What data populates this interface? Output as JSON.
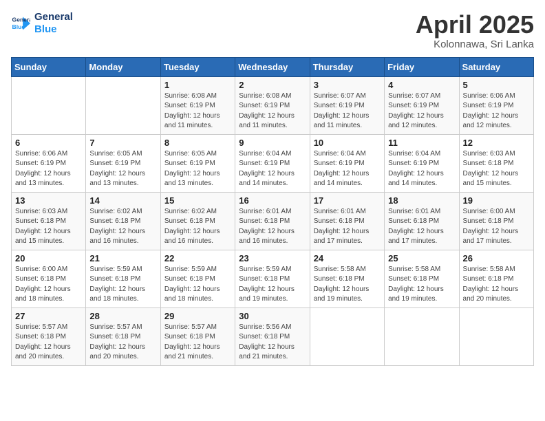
{
  "header": {
    "logo_line1": "General",
    "logo_line2": "Blue",
    "title": "April 2025",
    "subtitle": "Kolonnawa, Sri Lanka"
  },
  "days_of_week": [
    "Sunday",
    "Monday",
    "Tuesday",
    "Wednesday",
    "Thursday",
    "Friday",
    "Saturday"
  ],
  "weeks": [
    [
      {
        "day": "",
        "info": ""
      },
      {
        "day": "",
        "info": ""
      },
      {
        "day": "1",
        "info": "Sunrise: 6:08 AM\nSunset: 6:19 PM\nDaylight: 12 hours\nand 11 minutes."
      },
      {
        "day": "2",
        "info": "Sunrise: 6:08 AM\nSunset: 6:19 PM\nDaylight: 12 hours\nand 11 minutes."
      },
      {
        "day": "3",
        "info": "Sunrise: 6:07 AM\nSunset: 6:19 PM\nDaylight: 12 hours\nand 11 minutes."
      },
      {
        "day": "4",
        "info": "Sunrise: 6:07 AM\nSunset: 6:19 PM\nDaylight: 12 hours\nand 12 minutes."
      },
      {
        "day": "5",
        "info": "Sunrise: 6:06 AM\nSunset: 6:19 PM\nDaylight: 12 hours\nand 12 minutes."
      }
    ],
    [
      {
        "day": "6",
        "info": "Sunrise: 6:06 AM\nSunset: 6:19 PM\nDaylight: 12 hours\nand 13 minutes."
      },
      {
        "day": "7",
        "info": "Sunrise: 6:05 AM\nSunset: 6:19 PM\nDaylight: 12 hours\nand 13 minutes."
      },
      {
        "day": "8",
        "info": "Sunrise: 6:05 AM\nSunset: 6:19 PM\nDaylight: 12 hours\nand 13 minutes."
      },
      {
        "day": "9",
        "info": "Sunrise: 6:04 AM\nSunset: 6:19 PM\nDaylight: 12 hours\nand 14 minutes."
      },
      {
        "day": "10",
        "info": "Sunrise: 6:04 AM\nSunset: 6:19 PM\nDaylight: 12 hours\nand 14 minutes."
      },
      {
        "day": "11",
        "info": "Sunrise: 6:04 AM\nSunset: 6:19 PM\nDaylight: 12 hours\nand 14 minutes."
      },
      {
        "day": "12",
        "info": "Sunrise: 6:03 AM\nSunset: 6:18 PM\nDaylight: 12 hours\nand 15 minutes."
      }
    ],
    [
      {
        "day": "13",
        "info": "Sunrise: 6:03 AM\nSunset: 6:18 PM\nDaylight: 12 hours\nand 15 minutes."
      },
      {
        "day": "14",
        "info": "Sunrise: 6:02 AM\nSunset: 6:18 PM\nDaylight: 12 hours\nand 16 minutes."
      },
      {
        "day": "15",
        "info": "Sunrise: 6:02 AM\nSunset: 6:18 PM\nDaylight: 12 hours\nand 16 minutes."
      },
      {
        "day": "16",
        "info": "Sunrise: 6:01 AM\nSunset: 6:18 PM\nDaylight: 12 hours\nand 16 minutes."
      },
      {
        "day": "17",
        "info": "Sunrise: 6:01 AM\nSunset: 6:18 PM\nDaylight: 12 hours\nand 17 minutes."
      },
      {
        "day": "18",
        "info": "Sunrise: 6:01 AM\nSunset: 6:18 PM\nDaylight: 12 hours\nand 17 minutes."
      },
      {
        "day": "19",
        "info": "Sunrise: 6:00 AM\nSunset: 6:18 PM\nDaylight: 12 hours\nand 17 minutes."
      }
    ],
    [
      {
        "day": "20",
        "info": "Sunrise: 6:00 AM\nSunset: 6:18 PM\nDaylight: 12 hours\nand 18 minutes."
      },
      {
        "day": "21",
        "info": "Sunrise: 5:59 AM\nSunset: 6:18 PM\nDaylight: 12 hours\nand 18 minutes."
      },
      {
        "day": "22",
        "info": "Sunrise: 5:59 AM\nSunset: 6:18 PM\nDaylight: 12 hours\nand 18 minutes."
      },
      {
        "day": "23",
        "info": "Sunrise: 5:59 AM\nSunset: 6:18 PM\nDaylight: 12 hours\nand 19 minutes."
      },
      {
        "day": "24",
        "info": "Sunrise: 5:58 AM\nSunset: 6:18 PM\nDaylight: 12 hours\nand 19 minutes."
      },
      {
        "day": "25",
        "info": "Sunrise: 5:58 AM\nSunset: 6:18 PM\nDaylight: 12 hours\nand 19 minutes."
      },
      {
        "day": "26",
        "info": "Sunrise: 5:58 AM\nSunset: 6:18 PM\nDaylight: 12 hours\nand 20 minutes."
      }
    ],
    [
      {
        "day": "27",
        "info": "Sunrise: 5:57 AM\nSunset: 6:18 PM\nDaylight: 12 hours\nand 20 minutes."
      },
      {
        "day": "28",
        "info": "Sunrise: 5:57 AM\nSunset: 6:18 PM\nDaylight: 12 hours\nand 20 minutes."
      },
      {
        "day": "29",
        "info": "Sunrise: 5:57 AM\nSunset: 6:18 PM\nDaylight: 12 hours\nand 21 minutes."
      },
      {
        "day": "30",
        "info": "Sunrise: 5:56 AM\nSunset: 6:18 PM\nDaylight: 12 hours\nand 21 minutes."
      },
      {
        "day": "",
        "info": ""
      },
      {
        "day": "",
        "info": ""
      },
      {
        "day": "",
        "info": ""
      }
    ]
  ]
}
